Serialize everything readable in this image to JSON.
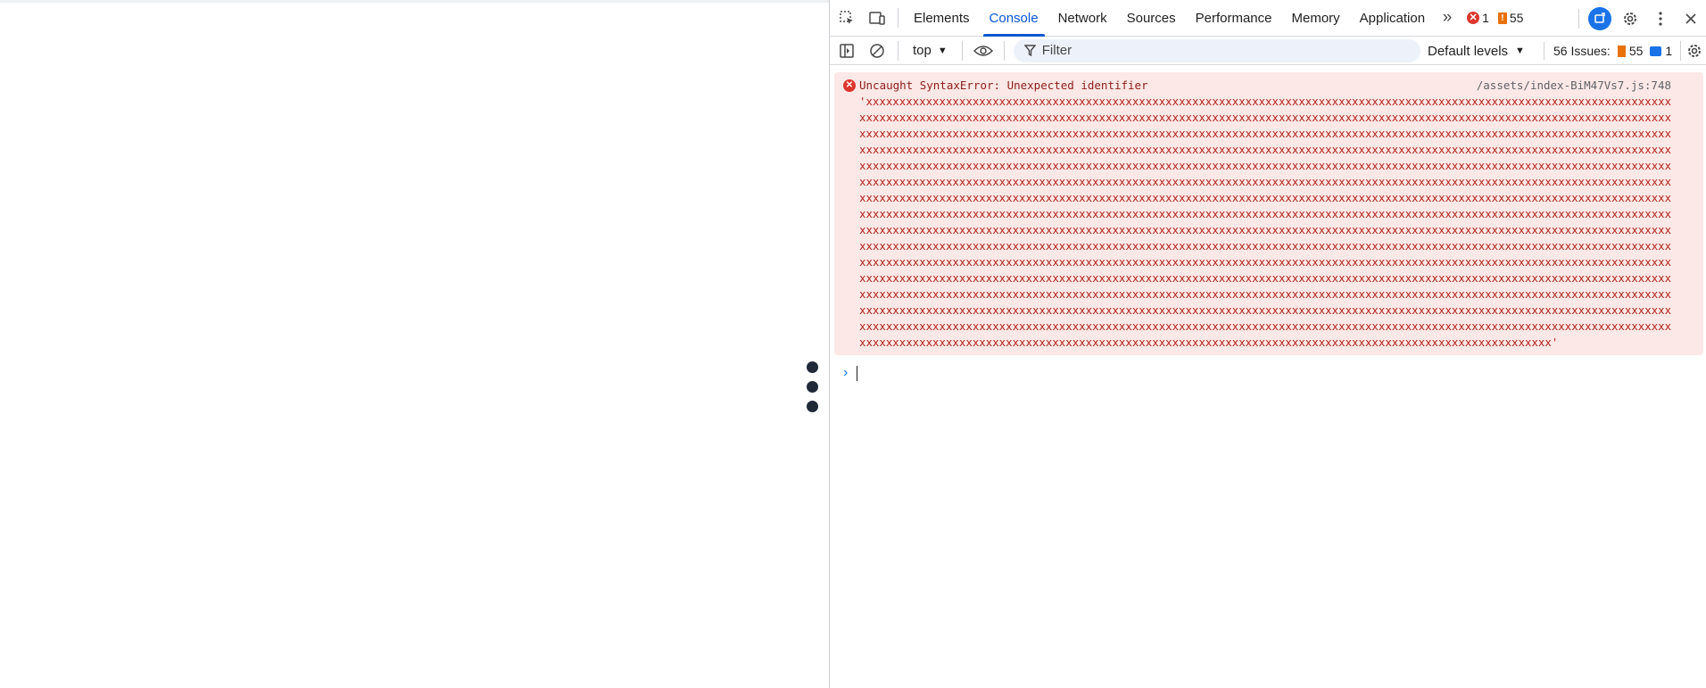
{
  "page": {
    "menu_icon": "vertical-dots-icon"
  },
  "devtools": {
    "toolbar_icons": [
      "inspect-element-icon",
      "device-toolbar-icon"
    ],
    "tabs": [
      {
        "label": "Elements",
        "active": false
      },
      {
        "label": "Console",
        "active": true
      },
      {
        "label": "Network",
        "active": false
      },
      {
        "label": "Sources",
        "active": false
      },
      {
        "label": "Performance",
        "active": false
      },
      {
        "label": "Memory",
        "active": false
      },
      {
        "label": "Application",
        "active": false
      }
    ],
    "more_tabs": "»",
    "error_count": "1",
    "warning_count": "55",
    "console_toolbar": {
      "context": "top",
      "filter_placeholder": "Filter",
      "levels": "Default levels",
      "issues_label": "56 Issues:",
      "issues_warn": "55",
      "issues_info": "1"
    },
    "error": {
      "message": "Uncaught SyntaxError: Unexpected identifier",
      "source": "/assets/index-BiM47Vs7.js:748",
      "body": "'xxxxxxxxxxxxxxxxxxxxxxxxxxxxxxxxxxxxxxxxxxxxxxxxxxxxxxxxxxxxxxxxxxxxxxxxxxxxxxxxxxxxxxxxxxxxxxxxxxxxxxxxxxxxxxxxxxxxxxxxx\nxxxxxxxxxxxxxxxxxxxxxxxxxxxxxxxxxxxxxxxxxxxxxxxxxxxxxxxxxxxxxxxxxxxxxxxxxxxxxxxxxxxxxxxxxxxxxxxxxxxxxxxxxxxxxxxxxxxxxxxxxx\nxxxxxxxxxxxxxxxxxxxxxxxxxxxxxxxxxxxxxxxxxxxxxxxxxxxxxxxxxxxxxxxxxxxxxxxxxxxxxxxxxxxxxxxxxxxxxxxxxxxxxxxxxxxxxxxxxxxxxxxxxx\nxxxxxxxxxxxxxxxxxxxxxxxxxxxxxxxxxxxxxxxxxxxxxxxxxxxxxxxxxxxxxxxxxxxxxxxxxxxxxxxxxxxxxxxxxxxxxxxxxxxxxxxxxxxxxxxxxxxxxxxxxx\nxxxxxxxxxxxxxxxxxxxxxxxxxxxxxxxxxxxxxxxxxxxxxxxxxxxxxxxxxxxxxxxxxxxxxxxxxxxxxxxxxxxxxxxxxxxxxxxxxxxxxxxxxxxxxxxxxxxxxxxxxx\nxxxxxxxxxxxxxxxxxxxxxxxxxxxxxxxxxxxxxxxxxxxxxxxxxxxxxxxxxxxxxxxxxxxxxxxxxxxxxxxxxxxxxxxxxxxxxxxxxxxxxxxxxxxxxxxxxxxxxxxxxx\nxxxxxxxxxxxxxxxxxxxxxxxxxxxxxxxxxxxxxxxxxxxxxxxxxxxxxxxxxxxxxxxxxxxxxxxxxxxxxxxxxxxxxxxxxxxxxxxxxxxxxxxxxxxxxxxxxxxxxxxxxx\nxxxxxxxxxxxxxxxxxxxxxxxxxxxxxxxxxxxxxxxxxxxxxxxxxxxxxxxxxxxxxxxxxxxxxxxxxxxxxxxxxxxxxxxxxxxxxxxxxxxxxxxxxxxxxxxxxxxxxxxxxx\nxxxxxxxxxxxxxxxxxxxxxxxxxxxxxxxxxxxxxxxxxxxxxxxxxxxxxxxxxxxxxxxxxxxxxxxxxxxxxxxxxxxxxxxxxxxxxxxxxxxxxxxxxxxxxxxxxxxxxxxxxx\nxxxxxxxxxxxxxxxxxxxxxxxxxxxxxxxxxxxxxxxxxxxxxxxxxxxxxxxxxxxxxxxxxxxxxxxxxxxxxxxxxxxxxxxxxxxxxxxxxxxxxxxxxxxxxxxxxxxxxxxxxx\nxxxxxxxxxxxxxxxxxxxxxxxxxxxxxxxxxxxxxxxxxxxxxxxxxxxxxxxxxxxxxxxxxxxxxxxxxxxxxxxxxxxxxxxxxxxxxxxxxxxxxxxxxxxxxxxxxxxxxxxxxx\nxxxxxxxxxxxxxxxxxxxxxxxxxxxxxxxxxxxxxxxxxxxxxxxxxxxxxxxxxxxxxxxxxxxxxxxxxxxxxxxxxxxxxxxxxxxxxxxxxxxxxxxxxxxxxxxxxxxxxxxxxx\nxxxxxxxxxxxxxxxxxxxxxxxxxxxxxxxxxxxxxxxxxxxxxxxxxxxxxxxxxxxxxxxxxxxxxxxxxxxxxxxxxxxxxxxxxxxxxxxxxxxxxxxxxxxxxxxxxxxxxxxxxx\nxxxxxxxxxxxxxxxxxxxxxxxxxxxxxxxxxxxxxxxxxxxxxxxxxxxxxxxxxxxxxxxxxxxxxxxxxxxxxxxxxxxxxxxxxxxxxxxxxxxxxxxxxxxxxxxxxxxxxxxxxx\nxxxxxxxxxxxxxxxxxxxxxxxxxxxxxxxxxxxxxxxxxxxxxxxxxxxxxxxxxxxxxxxxxxxxxxxxxxxxxxxxxxxxxxxxxxxxxxxxxxxxxxxxxxxxxxxxxxxxxxxxxx\nxxxxxxxxxxxxxxxxxxxxxxxxxxxxxxxxxxxxxxxxxxxxxxxxxxxxxxxxxxxxxxxxxxxxxxxxxxxxxxxxxxxxxxxxxxxxxxxxxxxxxxxx'"
    },
    "prompt_icon": "chevron-right-icon"
  }
}
